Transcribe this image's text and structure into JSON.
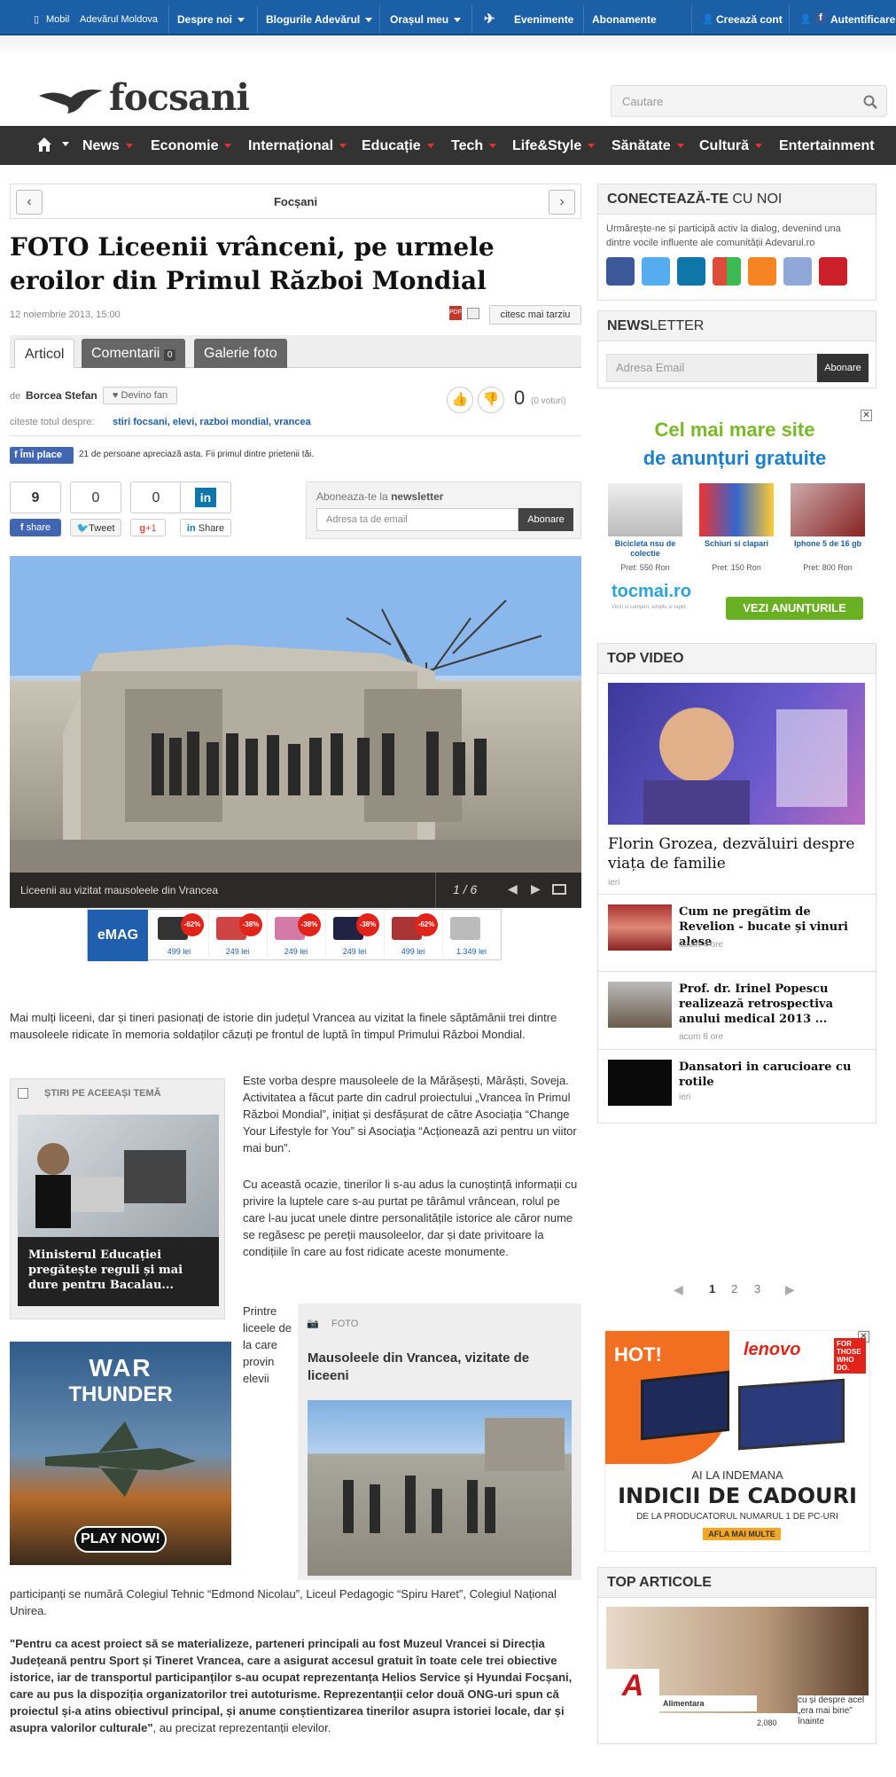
{
  "topbar": {
    "mobil": "Mobil",
    "moldova": "Adevărul Moldova",
    "despre": "Despre noi",
    "bloguri": "Blogurile Adevărul",
    "orasul": "Orașul meu",
    "evenimente": "Evenimente",
    "abonamente": "Abonamente",
    "creeaza": "Creează cont",
    "autentificare": "Autentificare"
  },
  "header": {
    "logo": "focsani",
    "search_placeholder": "Cautare"
  },
  "nav": [
    "News",
    "Economie",
    "Internațional",
    "Educație",
    "Tech",
    "Life&Style",
    "Sănătate",
    "Cultură",
    "Entertainment"
  ],
  "article": {
    "section": "Focșani",
    "title": "FOTO Liceenii vrânceni, pe urmele eroilor din Primul Război Mondial",
    "date": "12 noiembrie 2013, 15:00",
    "read_later": "citesc mai tarziu",
    "tabs": {
      "articol": "Articol",
      "comentarii": "Comentarii",
      "comentarii_count": "0",
      "galerie": "Galerie foto"
    },
    "by": "de",
    "author": "Borcea Stefan",
    "fan": "Devino fan",
    "votes": "0",
    "votes_label": "(0 voturi)",
    "tags_label": "citeste totul despre:",
    "tags": "stiri focsani, elevi, razboi mondial, vrancea",
    "like_btn": "Îmi place",
    "like_text": "21 de persoane apreciază asta. Fii primul dintre prietenii tăi.",
    "share": {
      "fb_count": "9",
      "tw_count": "0",
      "gp_count": "0",
      "fb": "share",
      "tw": "Tweet",
      "gp": "+1",
      "in": "Share"
    },
    "newsletter_label": "Aboneaza-te la",
    "newsletter_bold": "newsletter",
    "newsletter_placeholder": "Adresa ta de email",
    "newsletter_btn": "Abonare",
    "photo_caption": "Liceenii au vizitat mausoleele din Vrancea",
    "photo_counter": "1 / 6",
    "p1": "Mai mulți liceeni, dar și tineri  pasionați de istorie din județul Vrancea au vizitat la finele săptămânii trei dintre mausoleele ridicate în memoria soldaților căzuți pe frontul de luptă în timpul Primului Război Mondial.",
    "p2": "Este vorba despre mausoleele de la Mărășești, Mărăști, Soveja. Activitatea a făcut parte din cadrul proiectului „Vrancea în Primul Război Mondial”, inițiat și desfășurat de către Asociația “Change Your Lifestyle for You” si Asociația “Acționează azi pentru un viitor mai bun”.",
    "p3": "Cu această ocazie, tinerilor li s-au adus la cunoștință informații cu privire la luptele care s-au purtat pe târâmul vrâncean, rolul pe care l-au jucat unele dintre personalitățile istorice ale căror nume se regăsesc pe pereții mausoleelor, dar și date privitoare la condițiile în care au fost ridicate aceste monumente.",
    "p4a": "Printre liceele de la care provin elevii",
    "p4b": "participanți se numără Colegiul Tehnic “Edmond Nicolau”, Liceul Pedagogic “Spiru Haret”, Colegiul Național Unirea.",
    "p5": "\"Pentru ca acest proiect să se materializeze, parteneri principali au fost Muzeul Vrancei si Direcția Județeană pentru Sport și Tineret Vrancea, care a asigurat accesul gratuit în toate cele trei obiective istorice, iar de transportul participanților s-au ocupat reprezentanța Helios Service și Hyundai Focșani, care au pus la dispoziția organizatorilor trei autoturisme. Reprezentanții celor două ONG-uri spun că proiectul și-a atins obiectivul principal, și anume conștientizarea tinerilor asupra istoriei locale, dar și asupra valorilor culturale\"",
    "p5_tail": ", au precizat reprezentanții elevilor.",
    "related_head": "ȘTIRI PE ACEEAȘI TEMĂ",
    "related_title": "Ministerul Educației pregătește reguli și mai dure pentru Bacalau...",
    "foto_head": "FOTO",
    "foto_title": "Mausoleele din Vrancea, vizitate de liceeni"
  },
  "emag": {
    "logo": "eMAG",
    "items": [
      {
        "badge": "-62%",
        "price": "499 lei"
      },
      {
        "badge": "-38%",
        "price": "249 lei"
      },
      {
        "badge": "-38%",
        "price": "249 lei"
      },
      {
        "badge": "-38%",
        "price": "249 lei"
      },
      {
        "badge": "-62%",
        "price": "499 lei"
      },
      {
        "badge": "",
        "price": "1.349 lei"
      }
    ]
  },
  "wt_ad": {
    "title1": "WAR",
    "title2": "THUNDER",
    "btn": "PLAY NOW!"
  },
  "sidebar": {
    "conn_head_bold": "CONECTEAZĂ-TE",
    "conn_head": "CU NOI",
    "conn_text": "Urmărește-ne și participă activ la dialog, devenind una dintre vocile influente ale comunității Adevarul.ro",
    "news_head_bold": "NEWS",
    "news_head": "LETTER",
    "news_placeholder": "Adresa Email",
    "news_btn": "Abonare",
    "ad1": {
      "line1": "Cel mai mare site",
      "line2": "de anunțuri gratuite",
      "items": [
        {
          "name": "Bicicleta nsu de colectie",
          "price": "Pret: 550 Ron"
        },
        {
          "name": "Schiuri si clapari",
          "price": "Pret: 150 Ron"
        },
        {
          "name": "Iphone 5 de 16 gb",
          "price": "Pret: 800 Ron"
        }
      ],
      "logo": "tocmai.ro",
      "tagline": "Vinzi si cumperi, simplu si rapid",
      "cta": "VEZI ANUNȚURILE"
    },
    "video_head": "TOP VIDEO",
    "video_title": "Florin Grozea, dezvăluiri despre viața de familie",
    "video_time": "ieri",
    "articles": [
      {
        "title": "Cum ne pregătim de Revelion - bucate și vinuri alese",
        "time": "acum 4 ore"
      },
      {
        "title": "Prof. dr. Irinel Popescu realizează retrospectiva anului medical 2013 ...",
        "time": "acum 8 ore"
      },
      {
        "title": "Dansatori in carucioare cu rotile",
        "time": "ieri"
      }
    ],
    "pager": [
      "1",
      "2",
      "3"
    ],
    "ad2": {
      "hot": "HOT!",
      "brand": "lenovo",
      "tag1": "FOR",
      "tag2": "THOSE",
      "tag3": "WHO DO.",
      "line1": "AI LA INDEMANA",
      "line2": "INDICII DE CADOURI",
      "line3": "DE LA PRODUCATORUL NUMARUL 1 DE PC-URI",
      "cta": "AFLA MAI MULTE"
    },
    "top_head": "TOP ARTICOLE",
    "top_brand": "Alimentara",
    "top_count": "2,080",
    "top_text": "cu și despre acel „era mai bine” înainte"
  }
}
